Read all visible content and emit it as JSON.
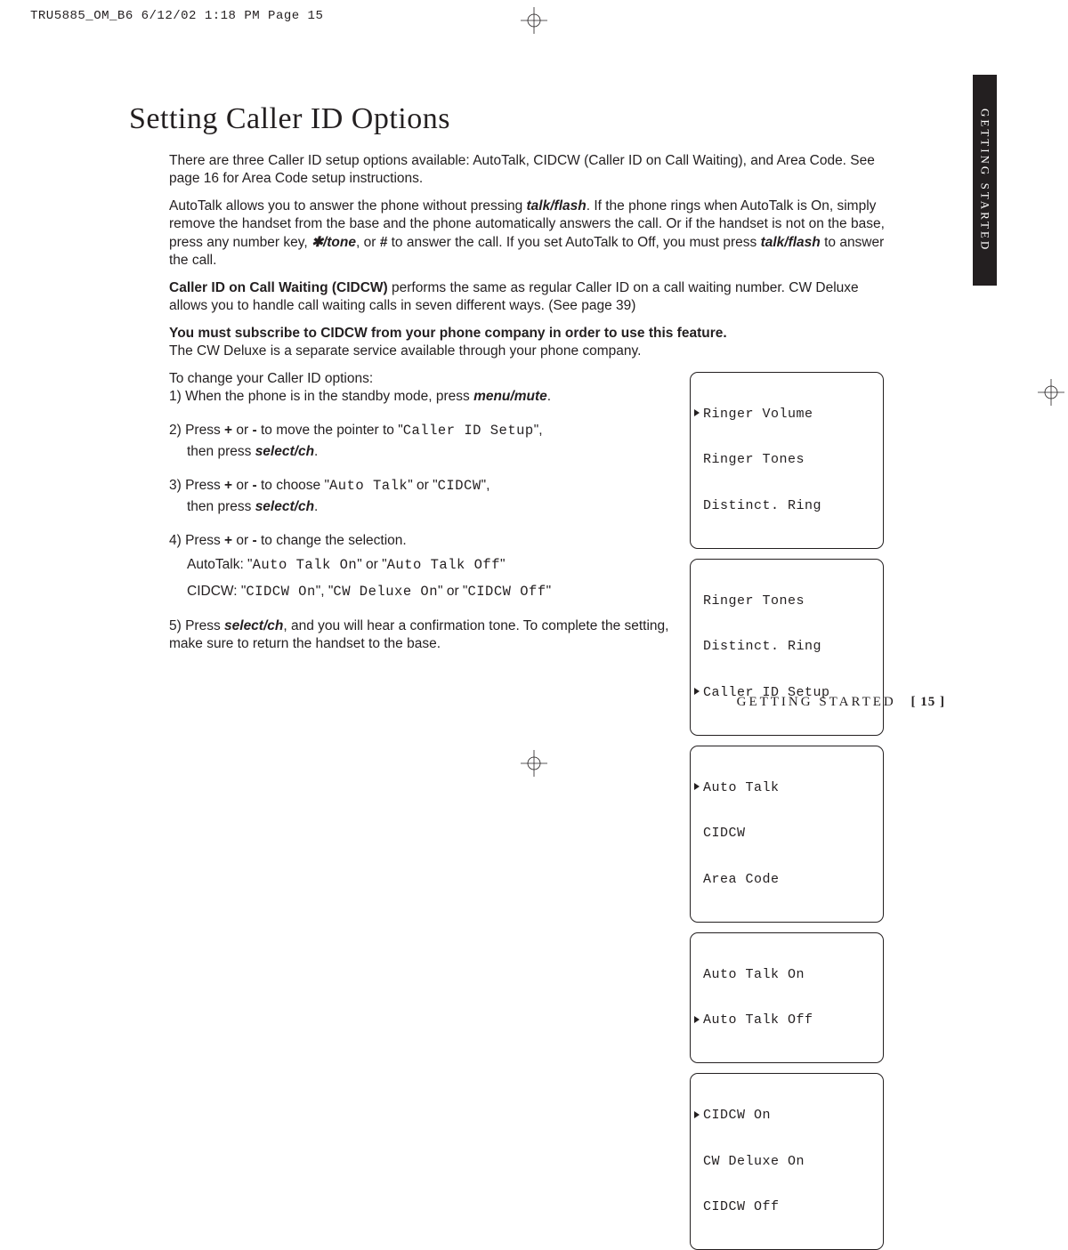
{
  "slug": "TRU5885_OM_B6  6/12/02  1:18 PM  Page 15",
  "sidetab": "GETTING STARTED",
  "title": "Setting Caller ID Options",
  "para1a": "There are three Caller ID setup options available: AutoTalk, CIDCW (Caller ID on Call Waiting), and Area Code. See page 16 for Area Code setup instructions.",
  "para2a": "AutoTalk allows you to answer the phone without pressing ",
  "talkflash": "talk/flash",
  "para2b": ". If the phone rings when AutoTalk is On, simply remove the handset from the base and the phone automatically answers the call. Or if the handset is not on the base, press any number key, ",
  "startone": "✱/tone",
  "para2c": ", or ",
  "hash": "#",
  "para2d": " to answer the call. If you set AutoTalk to Off, you must press ",
  "para2e": " to answer the call.",
  "cidcwlabel": "Caller ID on Call Waiting (CIDCW)",
  "para3b": " performs the same as regular Caller ID on a call waiting number. CW Deluxe allows you to handle call waiting calls in seven different ways. (See page 39)",
  "para4a": "You must subscribe to CIDCW from your phone company in order to use this feature.",
  "para4b": "The CW Deluxe is a separate service available through your phone company.",
  "intro": "To change your Caller ID options:",
  "s1a": "1) When the phone is in the standby mode, press ",
  "menumute": "menu/mute",
  "dot": ".",
  "s2a": "2) Press ",
  "plus": "+",
  "or": " or ",
  "minus": "-",
  "s2b": " to move the pointer to \"",
  "callerid": "Caller ID Setup",
  "s2c": "\",",
  "thenpress": "then press ",
  "selectch": "select/ch",
  "s3a": "3) Press ",
  "s3b": " to choose \"",
  "autotalk": "Auto Talk",
  "s3c": "\" or \"",
  "cidcw": "CIDCW",
  "s3d": "\",",
  "s4a": "4) Press ",
  "s4b": " to change the selection.",
  "s4at": "AutoTalk: \"",
  "aton": "Auto Talk On",
  "s4ator": "\" or \"",
  "atoff": "Auto Talk Off",
  "endq": "\"",
  "s4cid": "CIDCW: \"",
  "cidon": "CIDCW On",
  "s4cm": "\", \"",
  "cwdon": "CW Deluxe On",
  "cidoff": "CIDCW Off",
  "s5a": "5) Press ",
  "s5b": ", and you will hear a confirmation tone. To complete the setting, make sure to return the handset to the base.",
  "screens": {
    "a": [
      "Ringer Volume",
      "Ringer Tones",
      "Distinct. Ring"
    ],
    "b": [
      "Ringer Tones",
      "Distinct. Ring",
      "Caller ID Setup"
    ],
    "c": [
      "Auto Talk",
      "CIDCW",
      "Area Code"
    ],
    "d": [
      "Auto Talk On",
      "Auto Talk Off"
    ],
    "e": [
      "CIDCW On",
      "CW Deluxe On",
      "CIDCW Off"
    ]
  },
  "footer_section": "GETTING STARTED",
  "footer_page": "[ 15 ]"
}
